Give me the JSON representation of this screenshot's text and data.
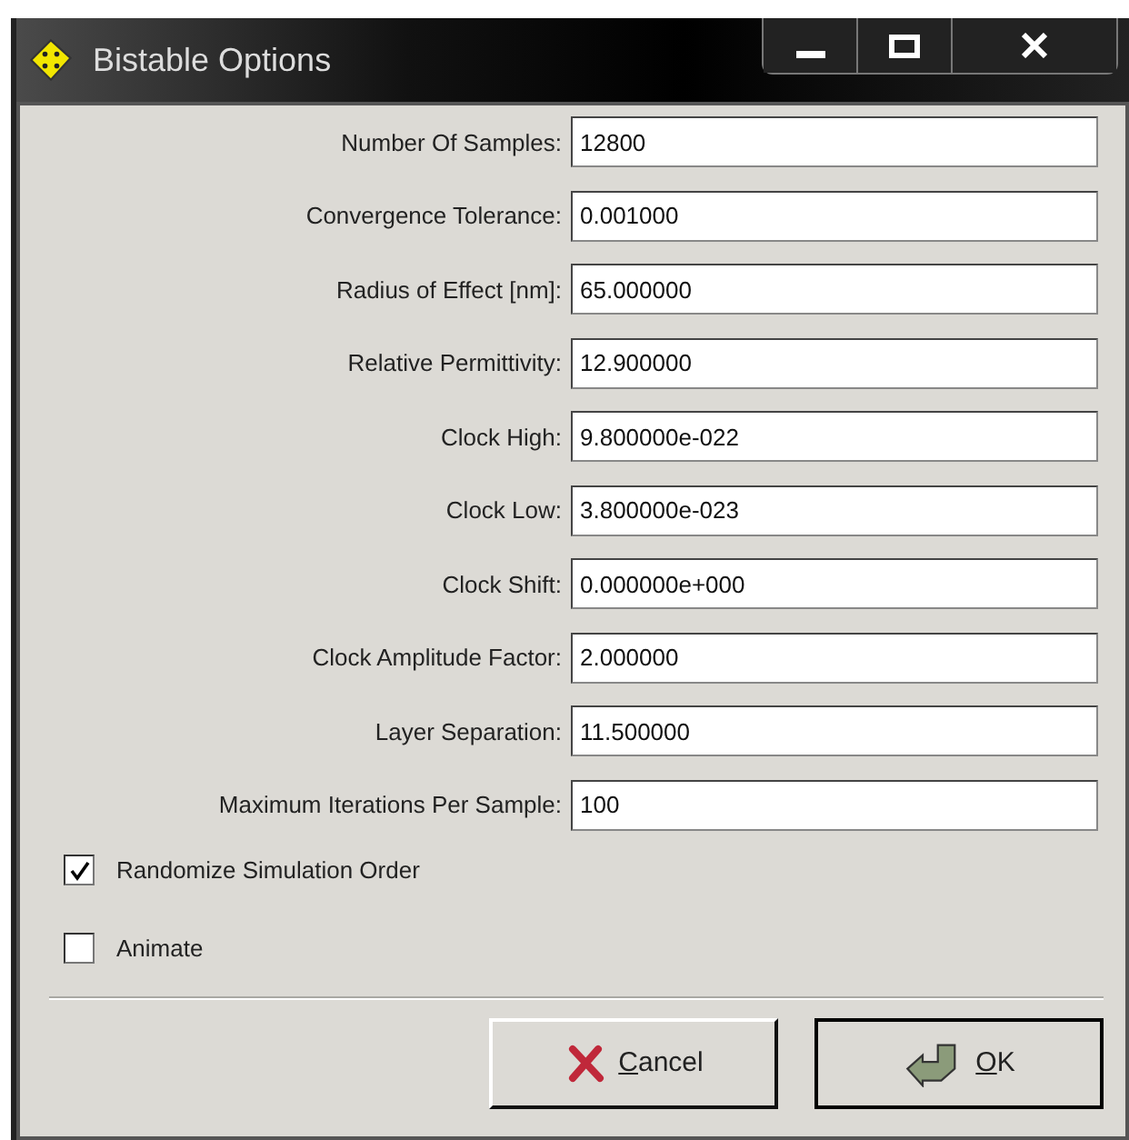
{
  "window": {
    "title": "Bistable Options",
    "controls": [
      {
        "kind": "minimize"
      },
      {
        "kind": "maximize"
      },
      {
        "kind": "close"
      }
    ]
  },
  "fields": [
    {
      "label": "Number Of Samples:",
      "value": "12800"
    },
    {
      "label": "Convergence Tolerance:",
      "value": "0.001000"
    },
    {
      "label": "Radius of Effect [nm]:",
      "value": "65.000000"
    },
    {
      "label": "Relative Permittivity:",
      "value": "12.900000"
    },
    {
      "label": "Clock High:",
      "value": "9.800000e-022"
    },
    {
      "label": "Clock Low:",
      "value": "3.800000e-023"
    },
    {
      "label": "Clock Shift:",
      "value": "0.000000e+000"
    },
    {
      "label": "Clock Amplitude Factor:",
      "value": "2.000000"
    },
    {
      "label": "Layer Separation:",
      "value": "11.500000"
    },
    {
      "label": "Maximum Iterations Per Sample:",
      "value": "100"
    }
  ],
  "checkboxes": [
    {
      "label": "Randomize Simulation Order",
      "checked": true
    },
    {
      "label": "Animate",
      "checked": false
    }
  ],
  "buttons": [
    {
      "kind": "cancel",
      "label": "Cancel"
    },
    {
      "kind": "ok",
      "label": "OK"
    }
  ]
}
